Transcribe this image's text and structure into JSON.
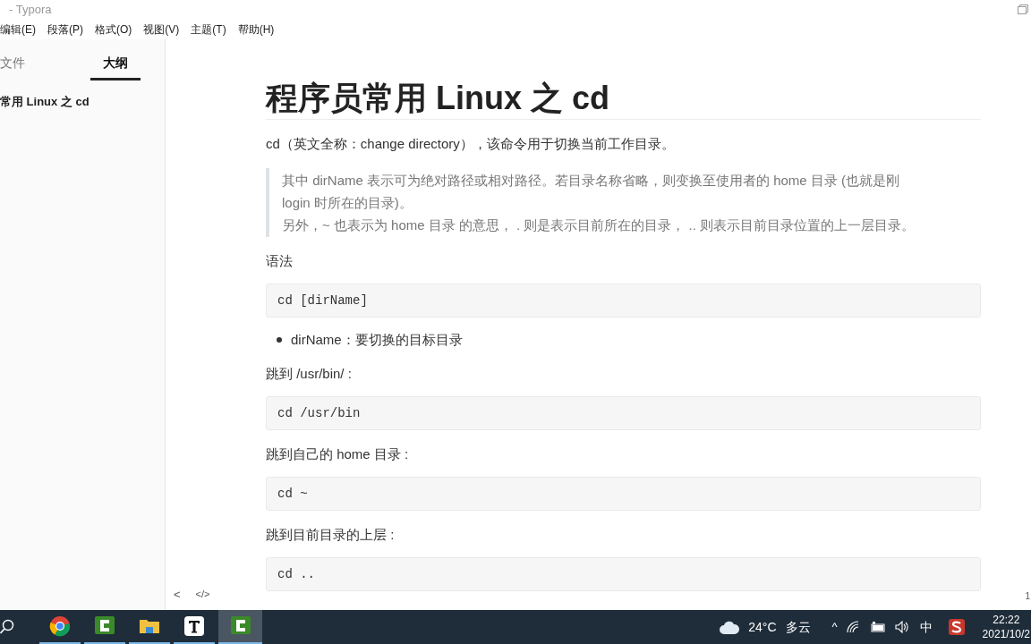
{
  "window": {
    "title": "- Typora"
  },
  "menu": [
    "编辑(E)",
    "段落(P)",
    "格式(O)",
    "视图(V)",
    "主题(T)",
    "帮助(H)"
  ],
  "sidebar": {
    "tabs": [
      {
        "label": "文件",
        "selected": false
      },
      {
        "label": "大纲",
        "selected": true
      }
    ],
    "outline": [
      {
        "label": "常用 Linux 之 cd"
      }
    ]
  },
  "document": {
    "title": "程序员常用 Linux 之 cd",
    "blocks": [
      {
        "kind": "paragraph",
        "text": "cd（英文全称：change directory），该命令用于切换当前工作目录。"
      },
      {
        "kind": "quote",
        "lines": [
          "其中 dirName 表示可为绝对路径或相对路径。若目录名称省略，则变换至使用者的 home 目录 (也就是刚",
          "login 时所在的目录)。",
          "另外，~ 也表示为 home 目录 的意思， . 则是表示目前所在的目录， .. 则表示目前目录位置的上一层目录。"
        ]
      },
      {
        "kind": "paragraph",
        "text": "语法"
      },
      {
        "kind": "code",
        "text": "cd [dirName]"
      },
      {
        "kind": "bullets",
        "items": [
          "dirName：要切换的目标目录"
        ]
      },
      {
        "kind": "paragraph",
        "text": "跳到 /usr/bin/ :"
      },
      {
        "kind": "code",
        "text": "cd /usr/bin"
      },
      {
        "kind": "paragraph",
        "text": "跳到自己的 home 目录 :"
      },
      {
        "kind": "code",
        "text": "cd ~"
      },
      {
        "kind": "paragraph",
        "text": "跳到目前目录的上层 :"
      },
      {
        "kind": "code",
        "text": "cd .."
      }
    ]
  },
  "status_bar": {
    "back": "<",
    "source": "</>",
    "count": "1"
  },
  "taskbar": {
    "apps": [
      {
        "kind": "browser",
        "selected": false
      },
      {
        "kind": "recorder",
        "selected": false
      },
      {
        "kind": "folder",
        "selected": false
      },
      {
        "kind": "editor",
        "selected": false
      },
      {
        "kind": "recorder",
        "selected": true
      }
    ],
    "weather": {
      "temp": "24°C",
      "condition": "多云"
    },
    "caret": "^",
    "ime": "中",
    "time": "22:22",
    "date": "2021/10/2"
  }
}
